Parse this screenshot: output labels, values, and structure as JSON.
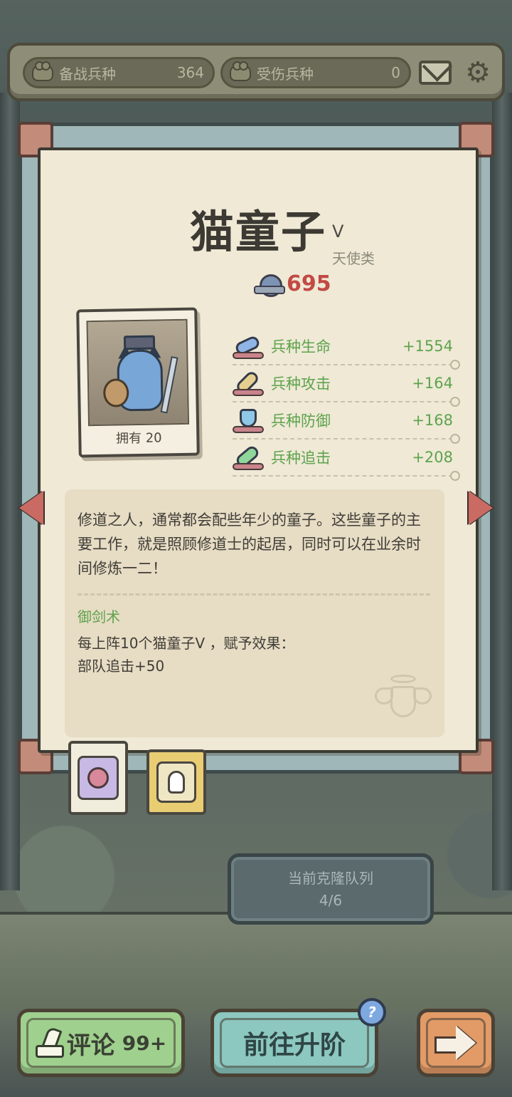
{
  "resources": {
    "ready_troops": {
      "label": "备战兵种",
      "value": "364",
      "icon": "frog-icon"
    },
    "injured_troops": {
      "label": "受伤兵种",
      "value": "0",
      "icon": "frog-icon"
    }
  },
  "unit": {
    "name": "猫童子",
    "tier": "V",
    "class": "天使类",
    "power": "695",
    "owned_label": "拥有 20"
  },
  "stats": [
    {
      "label": "兵种生命",
      "value": "+1554",
      "icon": "pill-icon",
      "color": "#5ea34d"
    },
    {
      "label": "兵种攻击",
      "value": "+164",
      "icon": "sword-icon",
      "color": "#5ea34d"
    },
    {
      "label": "兵种防御",
      "value": "+168",
      "icon": "shield-icon",
      "color": "#5ea34d"
    },
    {
      "label": "兵种追击",
      "value": "+208",
      "icon": "boot-icon",
      "color": "#5ea34d"
    }
  ],
  "description": {
    "lore": "修道之人，通常都会配些年少的童子。这些童子的主要工作，就是照顾修道士的起居，同时可以在业余时间修炼一二！",
    "skill_name": "御剑术",
    "skill_line1": "每上阵10个猫童子V ，赋予效果：",
    "skill_line2": "部队追击+50"
  },
  "clone_queue": {
    "title": "当前克隆队列",
    "count": "4/6"
  },
  "buttons": {
    "comment_label": "评论",
    "comment_count": "99+",
    "upgrade_label": "前往升阶",
    "upgrade_badge": "?"
  },
  "colors": {
    "power": "#c24a44",
    "stat_green": "#5ea34d",
    "comment_button": "#9fd08e",
    "upgrade_button": "#8cc7c0",
    "next_button": "#e29a67"
  }
}
